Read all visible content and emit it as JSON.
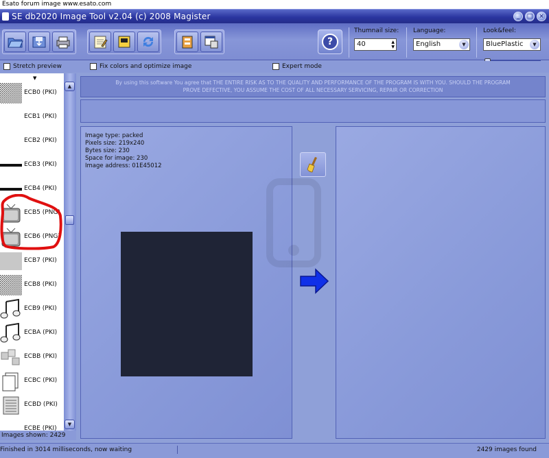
{
  "banner": {
    "text": "Esato forum image www.esato.com"
  },
  "window": {
    "title": "SE db2020 Image Tool v2.04 (c) 2008 Magister"
  },
  "toolbar": {
    "buttons": [
      "open-folder-icon",
      "save-icon",
      "print-icon",
      "notepad-icon",
      "export-icon",
      "refresh-icon",
      "archive-icon",
      "window-icon"
    ],
    "help_label": "?"
  },
  "options": {
    "thumbnail_label": "Thumnail size:",
    "thumbnail_value": "40",
    "language_label": "Language:",
    "language_value": "English",
    "lookfeel_label": "Look&feel:",
    "lookfeel_value": "BluePlastic",
    "slider_level": 0
  },
  "checkboxes": {
    "stretch": "Stretch preview",
    "fix_colors": "Fix colors and optimize image",
    "expert": "Expert mode"
  },
  "sidebar": {
    "items": [
      {
        "label": "ECB0 (PKI)",
        "thumb": "noise"
      },
      {
        "label": "ECB1 (PKI)",
        "thumb": "blank"
      },
      {
        "label": "ECB2 (PKI)",
        "thumb": "blank"
      },
      {
        "label": "ECB3 (PKI)",
        "thumb": "line"
      },
      {
        "label": "ECB4 (PKI)",
        "thumb": "line"
      },
      {
        "label": "ECB5 (PNG)",
        "thumb": "tv"
      },
      {
        "label": "ECB6 (PNG)",
        "thumb": "tv"
      },
      {
        "label": "ECB7 (PKI)",
        "thumb": "gray"
      },
      {
        "label": "ECB8 (PKI)",
        "thumb": "noise"
      },
      {
        "label": "ECB9 (PKI)",
        "thumb": "note"
      },
      {
        "label": "ECBA (PKI)",
        "thumb": "note"
      },
      {
        "label": "ECBB (PKI)",
        "thumb": "blocks"
      },
      {
        "label": "ECBC (PKI)",
        "thumb": "pages"
      },
      {
        "label": "ECBD (PKI)",
        "thumb": "list"
      },
      {
        "label": "ECBE (PKI)",
        "thumb": "blank"
      }
    ],
    "images_shown": "Images shown: 2429"
  },
  "disclaimer": {
    "line1": "By using this software You agree that THE ENTIRE RISK AS TO THE QUALITY AND PERFORMANCE OF THE PROGRAM IS WITH YOU. SHOULD THE PROGRAM",
    "line2": "PROVE DEFECTIVE, YOU ASSUME THE COST OF ALL NECESSARY SERVICING, REPAIR OR CORRECTION"
  },
  "image_info": {
    "type": "Image type: packed",
    "pixels": "Pixels size: 219x240",
    "bytes": "Bytes size: 230",
    "space": "Space for image: 230",
    "address": "Image address: 01E45012"
  },
  "status": {
    "message": "Finished in 3014 milliseconds, now waiting",
    "found": "2429 images found"
  },
  "colors": {
    "accent": "#2b36a0",
    "panel": "#8a9bda",
    "preview": "#1f2436",
    "highlight": "#e01010"
  }
}
